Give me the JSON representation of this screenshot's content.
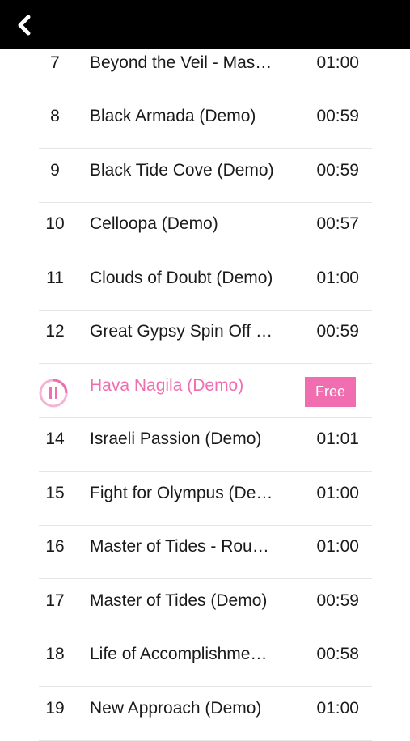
{
  "header": {
    "back_icon": "chevron-left-icon"
  },
  "accent_color": "#f06db0",
  "tracks": [
    {
      "num": "7",
      "title": "Beyond the Veil - Mas…",
      "duration": "01:00"
    },
    {
      "num": "8",
      "title": "Black Armada (Demo)",
      "duration": "00:59"
    },
    {
      "num": "9",
      "title": "Black Tide Cove (Demo)",
      "duration": "00:59"
    },
    {
      "num": "10",
      "title": "Celloopa (Demo)",
      "duration": "00:57"
    },
    {
      "num": "11",
      "title": "Clouds of Doubt (Demo)",
      "duration": "01:00"
    },
    {
      "num": "12",
      "title": "Great Gypsy Spin Off …",
      "duration": "00:59"
    },
    {
      "num": "",
      "title": "Hava Nagila (Demo)",
      "duration": "",
      "badge": "Free",
      "active": true,
      "icon": "pause-icon"
    },
    {
      "num": "14",
      "title": "Israeli Passion (Demo)",
      "duration": "01:01"
    },
    {
      "num": "15",
      "title": "Fight for Olympus (De…",
      "duration": "01:00"
    },
    {
      "num": "16",
      "title": "Master of Tides - Rou…",
      "duration": "01:00"
    },
    {
      "num": "17",
      "title": "Master of Tides (Demo)",
      "duration": "00:59"
    },
    {
      "num": "18",
      "title": "Life of Accomplishme…",
      "duration": "00:58"
    },
    {
      "num": "19",
      "title": "New Approach (Demo)",
      "duration": "01:00"
    }
  ]
}
